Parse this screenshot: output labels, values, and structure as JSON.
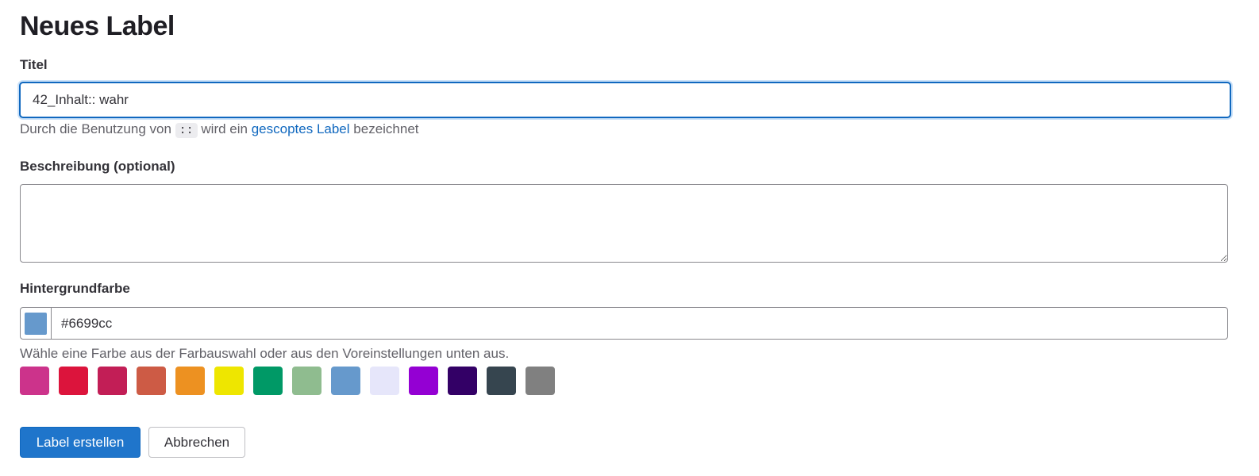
{
  "page": {
    "title": "Neues Label"
  },
  "title_field": {
    "label": "Titel",
    "value": "42_Inhalt:: wahr",
    "help_prefix": "Durch die Benutzung von",
    "help_code": "::",
    "help_middle": "wird ein",
    "help_link": "gescoptes Label",
    "help_suffix": "bezeichnet"
  },
  "description_field": {
    "label": "Beschreibung (optional)",
    "value": ""
  },
  "color_field": {
    "label": "Hintergrundfarbe",
    "value": "#6699cc",
    "help": "Wähle eine Farbe aus der Farbauswahl oder aus den Voreinstellungen unten aus.",
    "presets": [
      "#cc338b",
      "#dc143c",
      "#c21e56",
      "#cd5b45",
      "#ed9121",
      "#eee600",
      "#009966",
      "#8fbc8f",
      "#6699cc",
      "#e6e6fa",
      "#9400d3",
      "#330066",
      "#36454f",
      "#808080"
    ]
  },
  "actions": {
    "create_label": "Label erstellen",
    "cancel_label": "Abbrechen"
  }
}
